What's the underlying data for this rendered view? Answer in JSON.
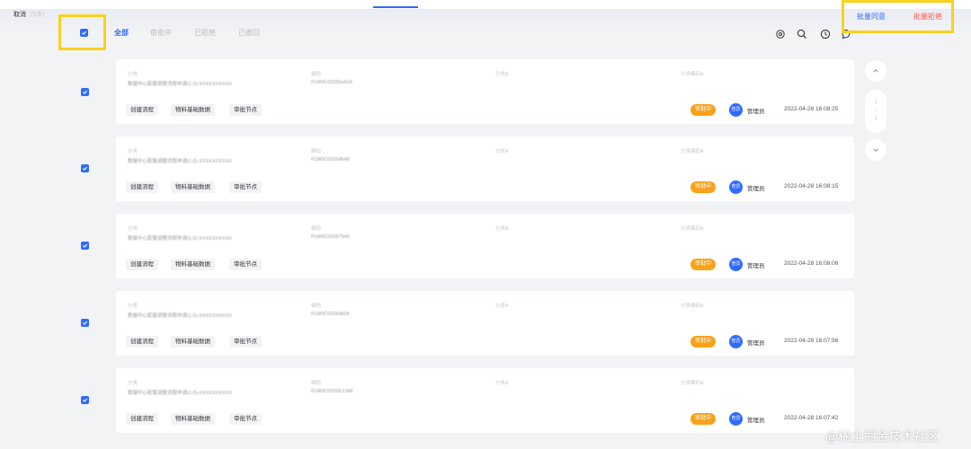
{
  "header": {
    "cancel_label": "取消",
    "selected_count": "(5条)",
    "batch_approve_label": "批量同意",
    "batch_reject_label": "批量拒绝"
  },
  "filter_tabs": [
    "全部",
    "审批中",
    "已拒绝",
    "已撤回"
  ],
  "toolbar_icons": [
    "gear-icon",
    "search-icon",
    "clock-icon",
    "message-icon"
  ],
  "records": [
    {
      "category_label": "分类",
      "category_value": "数据中心配置调整流程申请(1.0)-XXXXXXXXXX",
      "code_label": "编码",
      "code_value": "FLW0C02055e624",
      "cat_a_label": "分类A",
      "cat_code_a_label": "分类编码A",
      "tags": [
        "创建流程",
        "物料基础数据",
        "审批节点"
      ],
      "status": "审批中",
      "avatar_text": "管员",
      "owner": "管理员",
      "time": "2022-04-28 16:08:25"
    },
    {
      "category_label": "分类",
      "category_value": "数据中心配置调整流程申请(1.0)-XXXXXXXXXX",
      "code_label": "编码",
      "code_value": "FLW0C02054b48",
      "cat_a_label": "分类A",
      "cat_code_a_label": "分类编码A",
      "tags": [
        "创建流程",
        "物料基础数据",
        "审批节点"
      ],
      "status": "审批中",
      "avatar_text": "管员",
      "owner": "管理员",
      "time": "2022-04-28 16:08:15"
    },
    {
      "category_label": "分类",
      "category_value": "数据中心配置调整流程申请(1.0)-XXXXXXXXXX",
      "code_label": "编码",
      "code_value": "FLW0C02057940",
      "cat_a_label": "分类A",
      "cat_code_a_label": "分类编码A",
      "tags": [
        "创建流程",
        "物料基础数据",
        "审批节点"
      ],
      "status": "审批中",
      "avatar_text": "管员",
      "owner": "管理员",
      "time": "2022-04-28 16:08:06"
    },
    {
      "category_label": "分类",
      "category_value": "数据中心配置调整流程申请(1.0)-XXXXXXXXXX",
      "code_label": "编码",
      "code_value": "FLW0C02054b04",
      "cat_a_label": "分类A",
      "cat_code_a_label": "分类编码A",
      "tags": [
        "创建流程",
        "物料基础数据",
        "审批节点"
      ],
      "status": "审批中",
      "avatar_text": "管员",
      "owner": "管理员",
      "time": "2022-04-28 16:07:56"
    },
    {
      "category_label": "分类",
      "category_value": "数据中心配置调整流程申请(1.0)-XXXXXXXXXX",
      "code_label": "编码",
      "code_value": "FLW0C0205E1348",
      "cat_a_label": "分类A",
      "cat_code_a_label": "分类编码A",
      "tags": [
        "创建流程",
        "物料基础数据",
        "审批节点"
      ],
      "status": "审批中",
      "avatar_text": "管员",
      "owner": "管理员",
      "time": "2022-04-28 16:07:42"
    }
  ],
  "pager": {
    "current": "1",
    "separator": "/",
    "total": "1"
  },
  "watermark": "@稀土掘金技术社区",
  "colors": {
    "accent": "#2f6bff",
    "danger": "#ff5a4e",
    "status_pending": "#f7a21b",
    "highlight": "#f7d21e"
  }
}
